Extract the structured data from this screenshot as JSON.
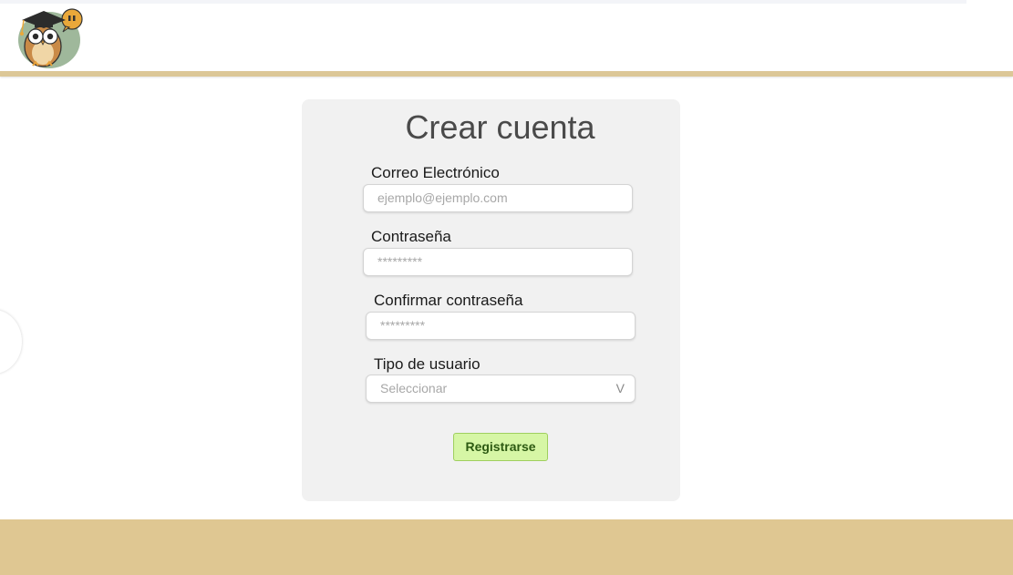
{
  "header": {
    "logo_icon": "owl-graduate-logo-icon"
  },
  "form": {
    "title": "Crear cuenta",
    "email": {
      "label": "Correo Electrónico",
      "placeholder": "ejemplo@ejemplo.com"
    },
    "password": {
      "label": "Contraseña",
      "placeholder": "*********"
    },
    "confirm_password": {
      "label": "Confirmar contraseña",
      "placeholder": "*********"
    },
    "user_type": {
      "label": "Tipo de usuario",
      "selected": "Seleccionar",
      "chevron": "V"
    },
    "submit_label": "Registrarse"
  },
  "colors": {
    "accent": "#dcc797",
    "footer": "#dfc792",
    "card": "#f1f1f1",
    "button_bg": "#d6f6a5",
    "button_text": "#2d5a12"
  }
}
